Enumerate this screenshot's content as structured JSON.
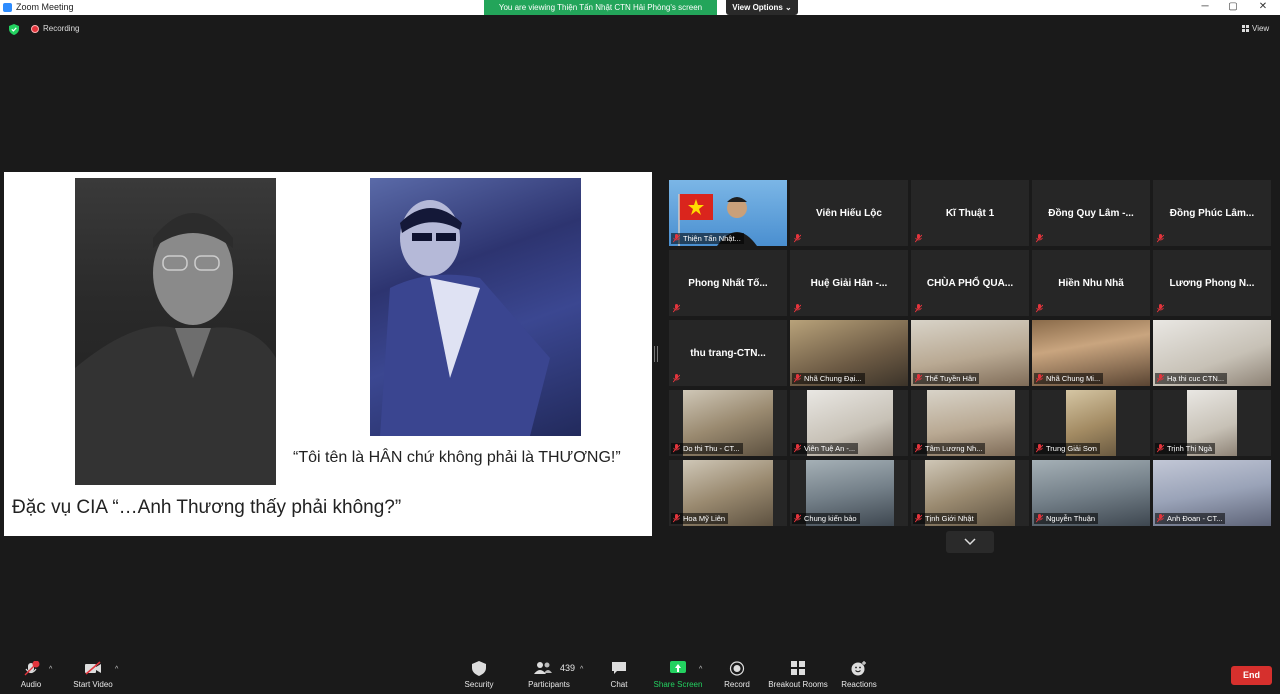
{
  "window": {
    "title": "Zoom Meeting",
    "viewing_banner": "You are viewing Thiện Tấn Nhật CTN Hải Phòng's screen",
    "view_options": "View Options ⌄",
    "controls": [
      "─",
      "▢",
      "✕"
    ]
  },
  "status": {
    "recording": "Recording",
    "view": "View"
  },
  "share": {
    "caption_right": "“Tôi tên là HÂN chứ không phải là THƯƠNG!”",
    "caption_left": "Đặc vụ CIA “…Anh Thương thấy phải không?”"
  },
  "gallery": [
    {
      "name": "Thiện Tấn Nhật...",
      "video": "flag",
      "active": true
    },
    {
      "name": "Viên Hiếu Lộc",
      "video": null
    },
    {
      "name": "Kĩ Thuật 1",
      "video": null
    },
    {
      "name": "Đồng Quy Lâm -...",
      "video": null
    },
    {
      "name": "Đồng Phúc Lâm...",
      "video": null
    },
    {
      "name": "Phong Nhất Tố...",
      "video": null
    },
    {
      "name": "Huệ Giải Hân -...",
      "video": null
    },
    {
      "name": "CHÙA PHỔ QUA...",
      "video": null
    },
    {
      "name": "Hiền Nhu Nhã",
      "video": null
    },
    {
      "name": "Lương Phong N...",
      "video": null
    },
    {
      "name": "thu trang-CTN...",
      "video": null
    },
    {
      "name": "Nhã Chung Đại...",
      "video": "a"
    },
    {
      "name": "Thể Tuyền Hân",
      "video": "b"
    },
    {
      "name": "Nhã Chung Mi...",
      "video": "d"
    },
    {
      "name": "Hạ thi cuc CTN...",
      "video": "e"
    },
    {
      "name": "Do thi Thu - CT...",
      "video": "c"
    },
    {
      "name": "Viên Tuệ An -...",
      "video": "e"
    },
    {
      "name": "Tâm Lương Nh...",
      "video": "b"
    },
    {
      "name": "Trung Giải Sơn",
      "video": "h"
    },
    {
      "name": "Trịnh Thị Ngà",
      "video": "e"
    },
    {
      "name": "Hoa Mỹ Liên",
      "video": "c"
    },
    {
      "name": "Chung kiến bảo",
      "video": "f"
    },
    {
      "name": "Tịnh Giới Nhật",
      "video": "c"
    },
    {
      "name": "Nguyễn Thuận",
      "video": "f"
    },
    {
      "name": "Anh Đoan - CT...",
      "video": "g"
    }
  ],
  "toolbar": {
    "audio": "Audio",
    "start_video": "Start Video",
    "security": "Security",
    "participants": "Participants",
    "participant_count": "439",
    "chat": "Chat",
    "share_screen": "Share Screen",
    "record": "Record",
    "breakout_rooms": "Breakout Rooms",
    "reactions": "Reactions",
    "end": "End"
  },
  "colors": {
    "accent_green": "#23a55a",
    "end_red": "#d6302d",
    "active_speaker": "#f5e84b"
  }
}
